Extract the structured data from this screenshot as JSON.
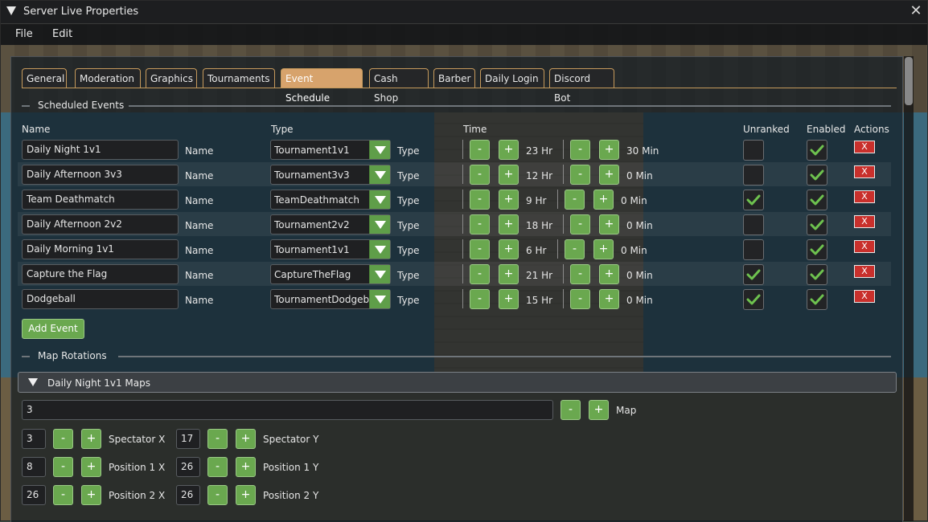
{
  "window": {
    "title": "Server Live Properties"
  },
  "menu": [
    "File",
    "Edit"
  ],
  "tabs": [
    "General",
    "Moderation",
    "Graphics",
    "Tournaments",
    "Event Schedule",
    "Cash Shop",
    "Barber",
    "Daily Login",
    "Discord Bot"
  ],
  "active_tab": "Event Schedule",
  "scheduled": {
    "section_title": "Scheduled Events",
    "headers": {
      "name": "Name",
      "type": "Type",
      "time": "Time",
      "unranked": "Unranked",
      "enabled": "Enabled",
      "actions": "Actions"
    },
    "name_label": "Name",
    "type_label": "Type",
    "events": [
      {
        "name": "Daily Night 1v1",
        "type": "Tournament1v1",
        "hours": "23 Hr",
        "minutes": "30 Min",
        "unranked": false,
        "enabled": true
      },
      {
        "name": "Daily Afternoon 3v3",
        "type": "Tournament3v3",
        "hours": "12 Hr",
        "minutes": "0 Min",
        "unranked": false,
        "enabled": true
      },
      {
        "name": "Team Deathmatch",
        "type": "TeamDeathmatch",
        "hours": "9 Hr",
        "minutes": "0 Min",
        "unranked": true,
        "enabled": true
      },
      {
        "name": "Daily Afternoon 2v2",
        "type": "Tournament2v2",
        "hours": "18 Hr",
        "minutes": "0 Min",
        "unranked": false,
        "enabled": true
      },
      {
        "name": "Daily Morning 1v1",
        "type": "Tournament1v1",
        "hours": "6 Hr",
        "minutes": "0 Min",
        "unranked": false,
        "enabled": true
      },
      {
        "name": "Capture the Flag",
        "type": "CaptureTheFlag",
        "hours": "21 Hr",
        "minutes": "0 Min",
        "unranked": true,
        "enabled": true
      },
      {
        "name": "Dodgeball",
        "type": "TournamentDodgeball",
        "hours": "15 Hr",
        "minutes": "0 Min",
        "unranked": true,
        "enabled": true
      }
    ],
    "minus": "-",
    "plus": "+",
    "delete": "X",
    "add_button": "Add Event"
  },
  "rotations": {
    "section_title": "Map Rotations",
    "group_title": "Daily Night 1v1 Maps",
    "map_value": "3",
    "map_label": "Map",
    "spectator_x": "3",
    "spectator_x_label": "Spectator X",
    "spectator_y": "17",
    "spectator_y_label": "Spectator Y",
    "pos1_x": "8",
    "pos1_x_label": "Position 1 X",
    "pos1_y": "26",
    "pos1_y_label": "Position 1 Y",
    "pos2_x": "26",
    "pos2_x_label": "Position 2 X",
    "pos2_y": "26",
    "pos2_y_label": "Position 2 Y"
  },
  "colors": {
    "accent_tab": "#d7a36c",
    "button_green": "#6aa84f",
    "delete_red": "#c9302c"
  }
}
